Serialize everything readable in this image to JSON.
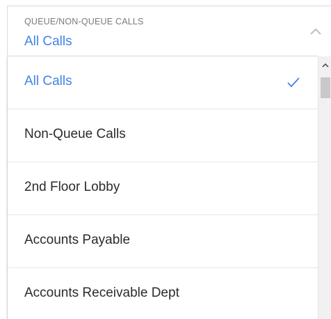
{
  "header": {
    "label": "QUEUE/NON-QUEUE CALLS",
    "selected_value": "All Calls",
    "chevron_icon": "chevron-up-icon"
  },
  "dropdown": {
    "items": [
      {
        "label": "All Calls",
        "selected": true
      },
      {
        "label": "Non-Queue Calls",
        "selected": false
      },
      {
        "label": "2nd Floor Lobby",
        "selected": false
      },
      {
        "label": "Accounts Payable",
        "selected": false
      },
      {
        "label": "Accounts Receivable Dept",
        "selected": false
      }
    ],
    "check_icon": "check-icon"
  },
  "colors": {
    "accent": "#3f83e6",
    "label_gray": "#7a7a7a",
    "text": "#2b2b2b"
  }
}
